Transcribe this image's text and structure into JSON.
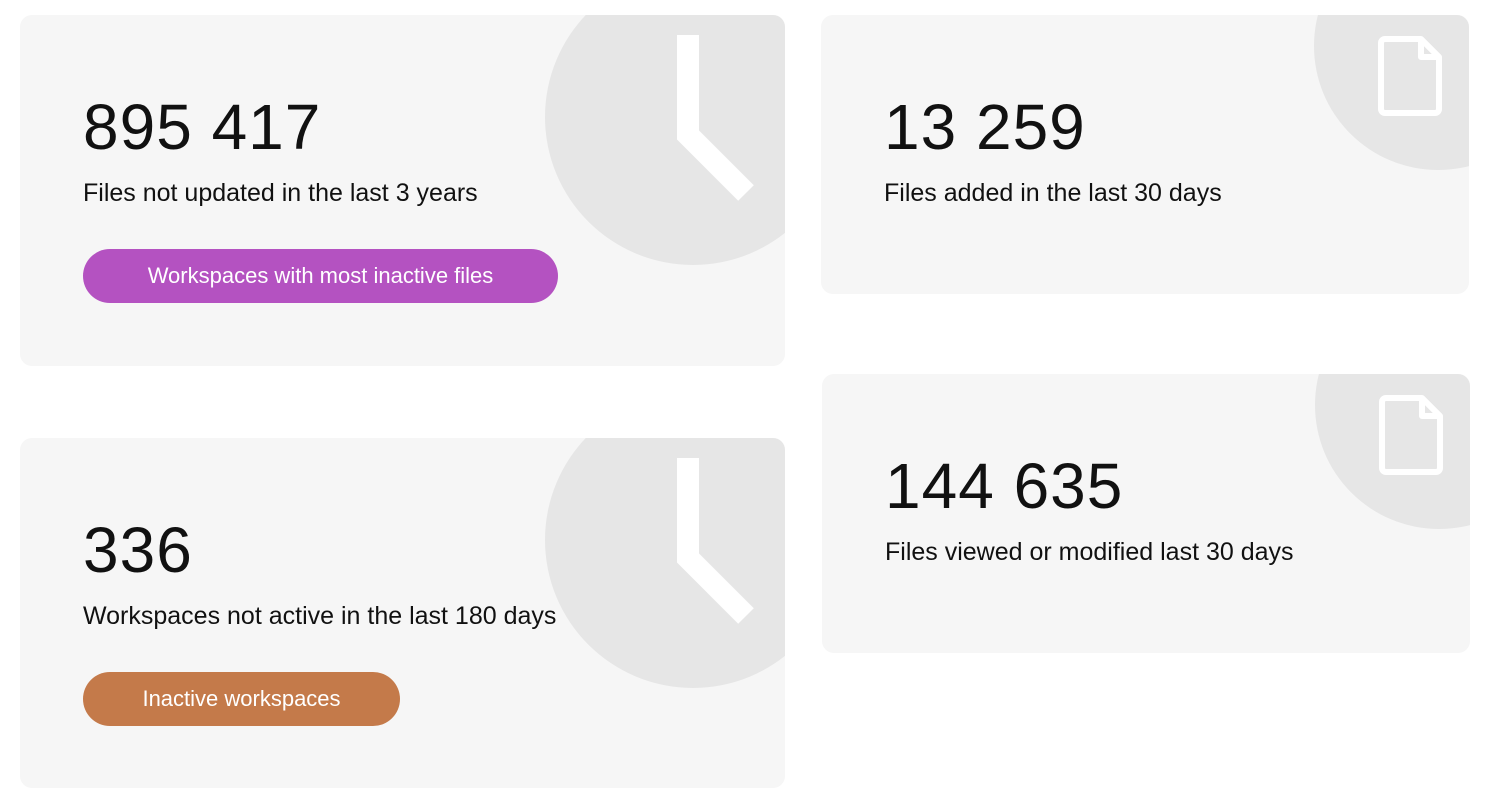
{
  "cards": {
    "inactive_files": {
      "value": "895 417",
      "label": "Files not updated in the last 3 years",
      "button_label": "Workspaces with most inactive files",
      "button_color": "#b452c1",
      "icon": "clock-icon"
    },
    "files_added": {
      "value": "13 259",
      "label": "Files added in the last 30 days",
      "icon": "file-icon"
    },
    "inactive_workspaces": {
      "value": "336",
      "label": "Workspaces not active in the last 180 days",
      "button_label": "Inactive workspaces",
      "button_color": "#c47a4a",
      "icon": "clock-icon"
    },
    "files_viewed": {
      "value": "144 635",
      "label": "Files viewed or modified last 30 days",
      "icon": "file-icon"
    }
  },
  "colors": {
    "card_bg": "#f6f6f6",
    "icon_circle": "#e6e6e6",
    "icon_stroke": "#ffffff"
  }
}
